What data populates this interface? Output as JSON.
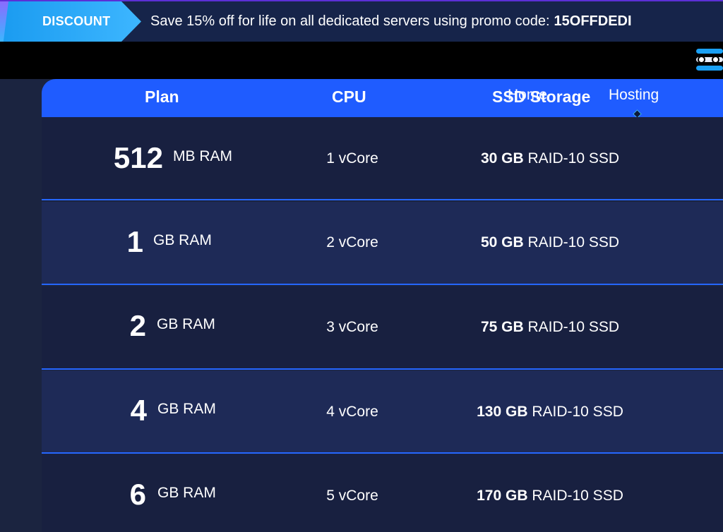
{
  "promo": {
    "tag": "DISCOUNT",
    "text": "Save 15% off for life on all dedicated servers using promo code:",
    "code": "15OFFDEDI"
  },
  "nav": {
    "menu_icon": "hamburger-menu-icon"
  },
  "table": {
    "headers": {
      "plan": "Plan",
      "cpu": "CPU",
      "ssd": "SSD Storage",
      "home": "Home",
      "hosting": "Hosting"
    },
    "rows": [
      {
        "ram_amount": "512",
        "ram_unit": "MB RAM",
        "cpu": "1 vCore",
        "ssd_size": "30 GB",
        "ssd_type": "RAID-10 SSD"
      },
      {
        "ram_amount": "1",
        "ram_unit": "GB RAM",
        "cpu": "2 vCore",
        "ssd_size": "50 GB",
        "ssd_type": "RAID-10 SSD"
      },
      {
        "ram_amount": "2",
        "ram_unit": "GB RAM",
        "cpu": "3 vCore",
        "ssd_size": "75 GB",
        "ssd_type": "RAID-10 SSD"
      },
      {
        "ram_amount": "4",
        "ram_unit": "GB RAM",
        "cpu": "4 vCore",
        "ssd_size": "130 GB",
        "ssd_type": "RAID-10 SSD"
      },
      {
        "ram_amount": "6",
        "ram_unit": "GB RAM",
        "cpu": "5 vCore",
        "ssd_size": "170 GB",
        "ssd_type": "RAID-10 SSD"
      }
    ]
  },
  "colors": {
    "header_blue": "#1f5cff",
    "row_dark": "#182040",
    "row_light": "#1e2a57",
    "divider": "#2566ff",
    "promo_accent": "#3db6ff"
  }
}
